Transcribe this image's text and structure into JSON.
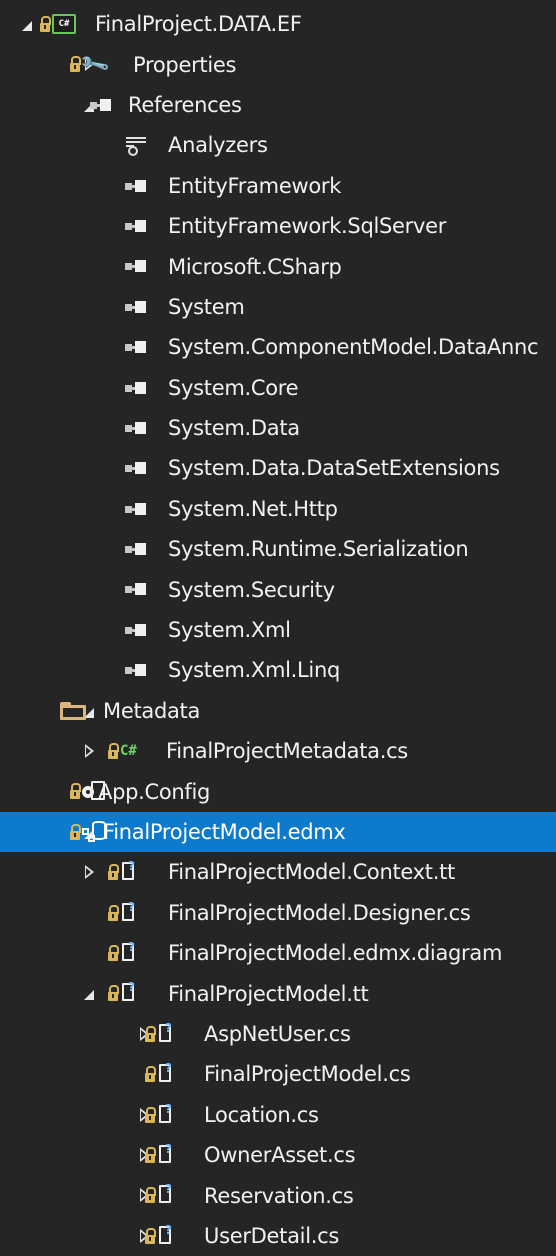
{
  "tree": {
    "rows": [
      {
        "label": "FinalProject.DATA.EF",
        "depth": 0,
        "toggle": "expanded",
        "icon": "csharp-project-icon",
        "lock": true,
        "selected": false
      },
      {
        "label": "Properties",
        "depth": 1,
        "toggle": "collapsed",
        "icon": "wrench-icon",
        "lock": true,
        "selected": false
      },
      {
        "label": "References",
        "depth": 1,
        "toggle": "expanded",
        "icon": "reference-icon",
        "lock": false,
        "selected": false
      },
      {
        "label": "Analyzers",
        "depth": 2,
        "toggle": "none",
        "icon": "analyzer-icon",
        "lock": false,
        "selected": false
      },
      {
        "label": "EntityFramework",
        "depth": 2,
        "toggle": "none",
        "icon": "reference-icon",
        "lock": false,
        "selected": false
      },
      {
        "label": "EntityFramework.SqlServer",
        "depth": 2,
        "toggle": "none",
        "icon": "reference-icon",
        "lock": false,
        "selected": false
      },
      {
        "label": "Microsoft.CSharp",
        "depth": 2,
        "toggle": "none",
        "icon": "reference-icon",
        "lock": false,
        "selected": false
      },
      {
        "label": "System",
        "depth": 2,
        "toggle": "none",
        "icon": "reference-icon",
        "lock": false,
        "selected": false
      },
      {
        "label": "System.ComponentModel.DataAnnc",
        "depth": 2,
        "toggle": "none",
        "icon": "reference-icon",
        "lock": false,
        "selected": false
      },
      {
        "label": "System.Core",
        "depth": 2,
        "toggle": "none",
        "icon": "reference-icon",
        "lock": false,
        "selected": false
      },
      {
        "label": "System.Data",
        "depth": 2,
        "toggle": "none",
        "icon": "reference-icon",
        "lock": false,
        "selected": false
      },
      {
        "label": "System.Data.DataSetExtensions",
        "depth": 2,
        "toggle": "none",
        "icon": "reference-icon",
        "lock": false,
        "selected": false
      },
      {
        "label": "System.Net.Http",
        "depth": 2,
        "toggle": "none",
        "icon": "reference-icon",
        "lock": false,
        "selected": false
      },
      {
        "label": "System.Runtime.Serialization",
        "depth": 2,
        "toggle": "none",
        "icon": "reference-icon",
        "lock": false,
        "selected": false
      },
      {
        "label": "System.Security",
        "depth": 2,
        "toggle": "none",
        "icon": "reference-icon",
        "lock": false,
        "selected": false
      },
      {
        "label": "System.Xml",
        "depth": 2,
        "toggle": "none",
        "icon": "reference-icon",
        "lock": false,
        "selected": false
      },
      {
        "label": "System.Xml.Linq",
        "depth": 2,
        "toggle": "none",
        "icon": "reference-icon",
        "lock": false,
        "selected": false
      },
      {
        "label": "Metadata",
        "depth": 1,
        "toggle": "expanded",
        "icon": "folder-icon",
        "lock": false,
        "selected": false
      },
      {
        "label": "FinalProjectMetadata.cs",
        "depth": 2,
        "toggle": "collapsed",
        "icon": "csharp-file-icon",
        "lock": true,
        "selected": false
      },
      {
        "label": "App.Config",
        "depth": 1,
        "toggle": "none",
        "icon": "config-file-icon",
        "lock": true,
        "selected": false
      },
      {
        "label": "FinalProjectModel.edmx",
        "depth": 1,
        "toggle": "expanded",
        "icon": "edmx-model-icon",
        "lock": true,
        "selected": true
      },
      {
        "label": "FinalProjectModel.Context.tt",
        "depth": 2,
        "toggle": "collapsed",
        "icon": "text-template-icon",
        "lock": true,
        "selected": false
      },
      {
        "label": "FinalProjectModel.Designer.cs",
        "depth": 2,
        "toggle": "none",
        "icon": "text-template-icon",
        "lock": true,
        "selected": false
      },
      {
        "label": "FinalProjectModel.edmx.diagram",
        "depth": 2,
        "toggle": "none",
        "icon": "text-template-icon",
        "lock": true,
        "selected": false
      },
      {
        "label": "FinalProjectModel.tt",
        "depth": 2,
        "toggle": "expanded",
        "icon": "text-template-icon",
        "lock": true,
        "selected": false
      },
      {
        "label": "AspNetUser.cs",
        "depth": 3,
        "toggle": "collapsed",
        "icon": "text-template-icon",
        "lock": true,
        "selected": false
      },
      {
        "label": "FinalProjectModel.cs",
        "depth": 3,
        "toggle": "none",
        "icon": "text-template-icon",
        "lock": true,
        "selected": false
      },
      {
        "label": "Location.cs",
        "depth": 3,
        "toggle": "collapsed",
        "icon": "text-template-icon",
        "lock": true,
        "selected": false
      },
      {
        "label": "OwnerAsset.cs",
        "depth": 3,
        "toggle": "collapsed",
        "icon": "text-template-icon",
        "lock": true,
        "selected": false
      },
      {
        "label": "Reservation.cs",
        "depth": 3,
        "toggle": "collapsed",
        "icon": "text-template-icon",
        "lock": true,
        "selected": false
      },
      {
        "label": "UserDetail.cs",
        "depth": 3,
        "toggle": "collapsed",
        "icon": "text-template-icon",
        "lock": true,
        "selected": false
      }
    ]
  },
  "colors": {
    "background": "#252526",
    "selection": "#0e7acb",
    "text": "#f1f1f1",
    "lock": "#d9b65a",
    "csharp": "#6fd36a"
  }
}
